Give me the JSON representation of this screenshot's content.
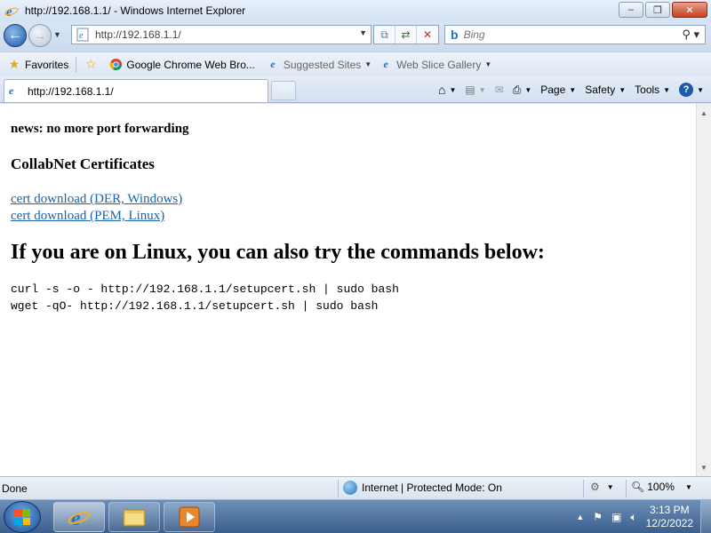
{
  "window": {
    "title": "http://192.168.1.1/ - Windows Internet Explorer",
    "controls": {
      "minimize": "–",
      "maximize": "❐",
      "close": "✕"
    }
  },
  "nav": {
    "address_url": "http://192.168.1.1/",
    "search_placeholder": "Bing",
    "search_provider_icon": "b"
  },
  "favorites_bar": {
    "favorites_label": "Favorites",
    "items": [
      {
        "label": "Google Chrome Web Bro...",
        "icon": "chrome-icon"
      },
      {
        "label": "Suggested Sites",
        "icon": "ie-page-icon"
      },
      {
        "label": "Web Slice Gallery",
        "icon": "ie-page-icon"
      }
    ]
  },
  "tab": {
    "label": "http://192.168.1.1/"
  },
  "command_bar": {
    "page": "Page",
    "safety": "Safety",
    "tools": "Tools"
  },
  "content": {
    "news": "news: no more port forwarding",
    "certs_heading": "CollabNet Certificates",
    "links": [
      "cert download (DER, Windows)",
      "cert download (PEM, Linux)"
    ],
    "linux_heading": "If you are on Linux, you can also try the commands below:",
    "commands": [
      "curl -s -o - http://192.168.1.1/setupcert.sh | sudo bash",
      "wget -qO- http://192.168.1.1/setupcert.sh | sudo bash"
    ]
  },
  "status": {
    "state": "Done",
    "zone": "Internet | Protected Mode: On",
    "zoom": "100%"
  },
  "taskbar": {
    "time": "3:13 PM",
    "date": "12/2/2022"
  },
  "colors": {
    "link": "#1a62ad",
    "titlebar": "#d3e2f3",
    "taskbar": "#3b5f8d"
  }
}
